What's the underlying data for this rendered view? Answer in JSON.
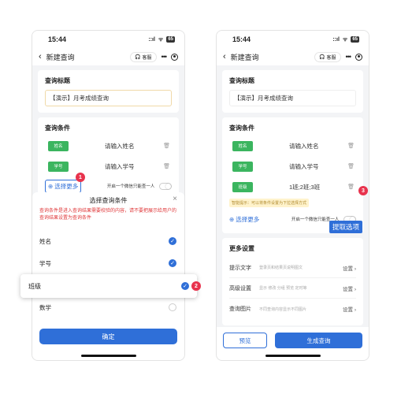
{
  "status": {
    "time": "15:44",
    "signal": "::ıl",
    "wifi": "ᯤ",
    "battery": "65"
  },
  "nav": {
    "back_icon": "‹",
    "title": "新建查询",
    "service_label": "客服",
    "service_icon": "headset-icon",
    "more_icon": "•••",
    "target_icon": "record-icon"
  },
  "query_title": {
    "heading": "查询标题",
    "value": "【演示】月考成绩查询"
  },
  "conditions": {
    "heading": "查询条件",
    "left_fields": [
      {
        "tag": "姓名",
        "value": "请输入姓名"
      },
      {
        "tag": "学号",
        "value": "请输入学号"
      }
    ],
    "right_fields": [
      {
        "tag": "姓名",
        "value": "请输入姓名"
      },
      {
        "tag": "学号",
        "value": "请输入学号"
      },
      {
        "tag": "班级",
        "value": "1班;2班;3班"
      }
    ],
    "select_more": "选择更多",
    "single_wechat": "开启一个微信只能查一人",
    "hint": "智能提示：可以将条件设置为下拉选择方式"
  },
  "modal": {
    "title": "选择查询条件",
    "close_icon": "×",
    "warning": "查询条件是进入查询结果需要校验的内容，请不要把展示给用户的查询结果设置为查询条件",
    "options": [
      {
        "label": "姓名",
        "checked": true
      },
      {
        "label": "学号",
        "checked": true
      },
      {
        "label": "班级",
        "checked": true
      },
      {
        "label": "数学",
        "checked": false
      }
    ],
    "confirm": "确定"
  },
  "extract_button": "提取选项",
  "badges": {
    "one": "1",
    "two": "2",
    "three": "3"
  },
  "more_settings": {
    "heading": "更多设置",
    "rows": [
      {
        "label": "提示文字",
        "desc": "登录页和结果页说明图文",
        "action": "设置"
      },
      {
        "label": "高级设置",
        "desc": "显示 修改 分组 预览 定时等",
        "action": "设置"
      },
      {
        "label": "查询图片",
        "desc": "不同查询内容显示不同图片",
        "action": "设置"
      }
    ]
  },
  "buttons": {
    "preview": "预览",
    "generate": "生成查询"
  },
  "colors": {
    "accent": "#2f6fd8",
    "tag_green": "#3bb55f",
    "badge_red": "#e8334d",
    "warning_red": "#e0393b"
  }
}
